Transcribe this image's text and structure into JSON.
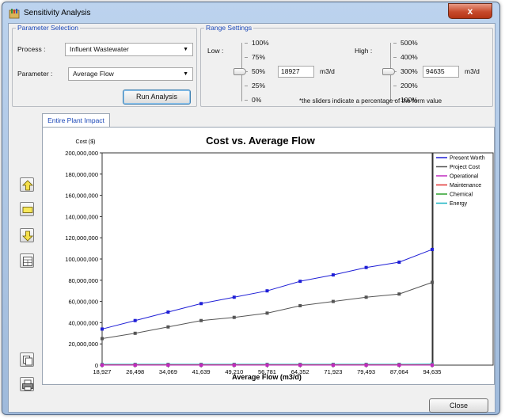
{
  "window": {
    "title": "Sensitivity Analysis",
    "close_glyph": "x"
  },
  "parameter_selection": {
    "title": "Parameter Selection",
    "process_label": "Process :",
    "process_value": "Influent Wastewater",
    "parameter_label": "Parameter :",
    "parameter_value": "Average Flow",
    "run_button": "Run Analysis"
  },
  "range_settings": {
    "title": "Range Settings",
    "low_label": "Low :",
    "low_ticks": [
      "100%",
      "75%",
      "50%",
      "25%",
      "0%"
    ],
    "low_selected": "50%",
    "low_value": "18927",
    "low_unit": "m3/d",
    "high_label": "High :",
    "high_ticks": [
      "500%",
      "400%",
      "300%",
      "200%",
      "100%"
    ],
    "high_selected": "300%",
    "high_value": "94635",
    "high_unit": "m3/d",
    "note": "*the sliders indicate a percentage of the form value"
  },
  "tabs": [
    {
      "label": "Entire Plant Impact",
      "active": true
    }
  ],
  "side_toolbar": {
    "icons": [
      "arrow-up-icon",
      "rectangle-icon",
      "arrow-down-icon",
      "table-icon",
      "copy-icon",
      "print-icon"
    ],
    "colors": {
      "up_down_fill": "#f5e04a",
      "rect_fill": "#f7e85a"
    }
  },
  "footer": {
    "close_button": "Close"
  },
  "chart_data": {
    "type": "line",
    "title": "Cost vs. Average Flow",
    "ylabel": "Cost ($)",
    "xlabel": "Average Flow (m3/d)",
    "x": [
      18927,
      26498,
      34069,
      41639,
      49210,
      56781,
      64352,
      71923,
      79493,
      87064,
      94635
    ],
    "x_tick_labels": [
      "18,927",
      "26,498",
      "34,069",
      "41,639",
      "49,210",
      "56,781",
      "64,352",
      "71,923",
      "79,493",
      "87,064",
      "94,635"
    ],
    "ylim": [
      0,
      200000000
    ],
    "y_tick_labels": [
      "0",
      "20,000,000",
      "40,000,000",
      "60,000,000",
      "80,000,000",
      "100,000,000",
      "120,000,000",
      "140,000,000",
      "160,000,000",
      "180,000,000",
      "200,000,000"
    ],
    "grid": false,
    "legend_position": "right",
    "series": [
      {
        "name": "Present Worth",
        "color": "#1f1fd6",
        "values": [
          34000000,
          42000000,
          50000000,
          58000000,
          64000000,
          70000000,
          79000000,
          85000000,
          92000000,
          97000000,
          109000000
        ]
      },
      {
        "name": "Project Cost",
        "color": "#555555",
        "values": [
          25000000,
          30000000,
          36000000,
          42000000,
          45000000,
          49000000,
          56000000,
          60000000,
          64000000,
          67000000,
          78000000
        ]
      },
      {
        "name": "Operational",
        "color": "#c02ac0",
        "values": [
          0,
          0,
          0,
          0,
          0,
          0,
          0,
          0,
          0,
          0,
          0
        ]
      },
      {
        "name": "Maintenance",
        "color": "#e03030",
        "values": [
          300000,
          300000,
          300000,
          300000,
          300000,
          300000,
          300000,
          300000,
          300000,
          300000,
          300000
        ]
      },
      {
        "name": "Chemical",
        "color": "#2ca02c",
        "values": [
          0,
          0,
          0,
          0,
          0,
          0,
          0,
          0,
          0,
          0,
          0
        ]
      },
      {
        "name": "Energy",
        "color": "#17b3c2",
        "values": [
          800000,
          800000,
          800000,
          800000,
          800000,
          800000,
          800000,
          800000,
          800000,
          800000,
          1000000
        ]
      }
    ]
  }
}
